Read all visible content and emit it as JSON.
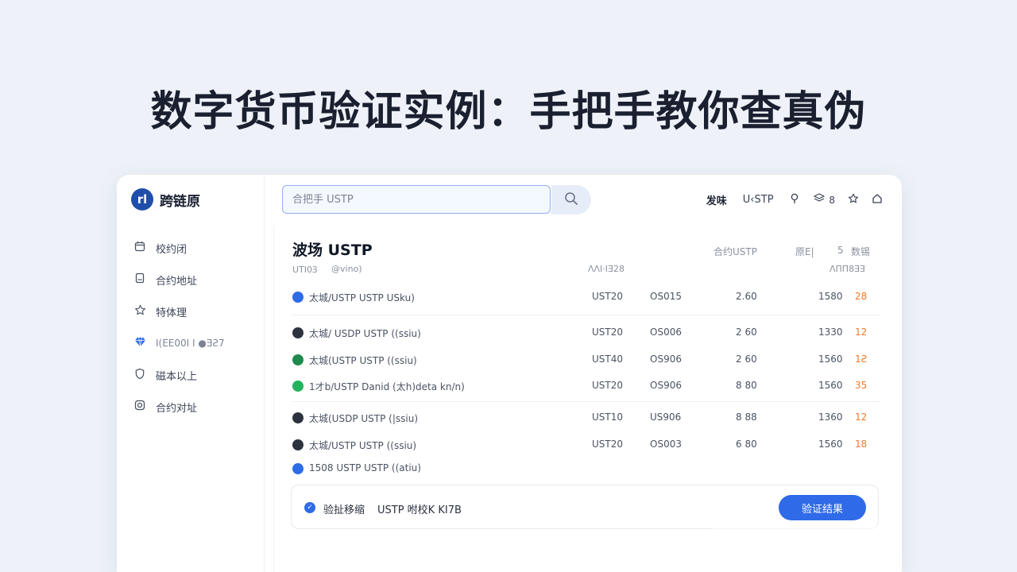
{
  "headline": "数字货币验证实例：手把手教你查真伪",
  "brand": {
    "logo_glyph": "rl",
    "name": "跨链原"
  },
  "sidebar": {
    "items": [
      {
        "icon": "calendar-icon",
        "label": "校约闭"
      },
      {
        "icon": "document-icon",
        "label": "合约地址"
      },
      {
        "icon": "star-icon",
        "label": "特体理"
      },
      {
        "icon": "diamond-icon",
        "label": "I(EE00I I ●ƎƧ7"
      },
      {
        "icon": "shield-icon",
        "label": "磁本以上"
      },
      {
        "icon": "instagram-icon",
        "label": "合约对址"
      }
    ]
  },
  "search": {
    "placeholder": "合把手 USTP"
  },
  "topbar": {
    "publish": "发味",
    "network": "U‹STP",
    "counter": "8"
  },
  "main": {
    "title": "波场 USTP",
    "meta_left": "合约USTP",
    "meta_mid": "原E|",
    "meta_num": "5",
    "meta_right": "数锡",
    "sub_col1": "UTI0Ɜ",
    "sub_col2": "@vino)",
    "sub_col3": "ΛΛΙ·ΙƎ28",
    "sub_col4": "ΛΠΠ8ƎƎ"
  },
  "rows": [
    {
      "dot_color": "#2e6be6",
      "name": "太城/USTP   USTP  USku)",
      "c1": "UST20",
      "c2": "OS015",
      "c3": "2.60",
      "c4": "1580",
      "c5": "28"
    },
    {
      "dot_color": "#2c3240",
      "name": "太城/ USDP   USTP  ((ssiu)",
      "c1": "UST20",
      "c2": "OS006",
      "c3": "2 60",
      "c4": "1330",
      "c5": "12"
    },
    {
      "dot_color": "#1f8a4c",
      "name": "太城(USTP   USTP  ((ssiu)",
      "c1": "UST40",
      "c2": "OS906",
      "c3": "2 60",
      "c4": "1560",
      "c5": "1Ƨ"
    },
    {
      "dot_color": "#22b35e",
      "name": "1才b/USTP   Danid  (太h)deta kn/n)",
      "c1": "UST20",
      "c2": "OS906",
      "c3": "8 80",
      "c4": "1560",
      "c5": "35"
    },
    {
      "dot_color": "#2c3240",
      "name": "太城(USDP   USTP  (|ssiu)",
      "c1": "UST10",
      "c2": "US906",
      "c3": "8 88",
      "c4": "1360",
      "c5": "12"
    },
    {
      "dot_color": "#2c3240",
      "name": "太城/USTP   USTP  ((ssiu)",
      "c1": "UST20",
      "c2": "OS003",
      "c3": "6 80",
      "c4": "1560",
      "c5": "18"
    },
    {
      "dot_color": "#2e6be6",
      "name": "1508 USTP   USTP  ((atiu)",
      "c1": "",
      "c2": "",
      "c3": "",
      "c4": "",
      "c5": ""
    }
  ],
  "verify": {
    "label": "验扯移缩",
    "code": "USTP 咐校K KI7B",
    "button": "验证结果"
  }
}
